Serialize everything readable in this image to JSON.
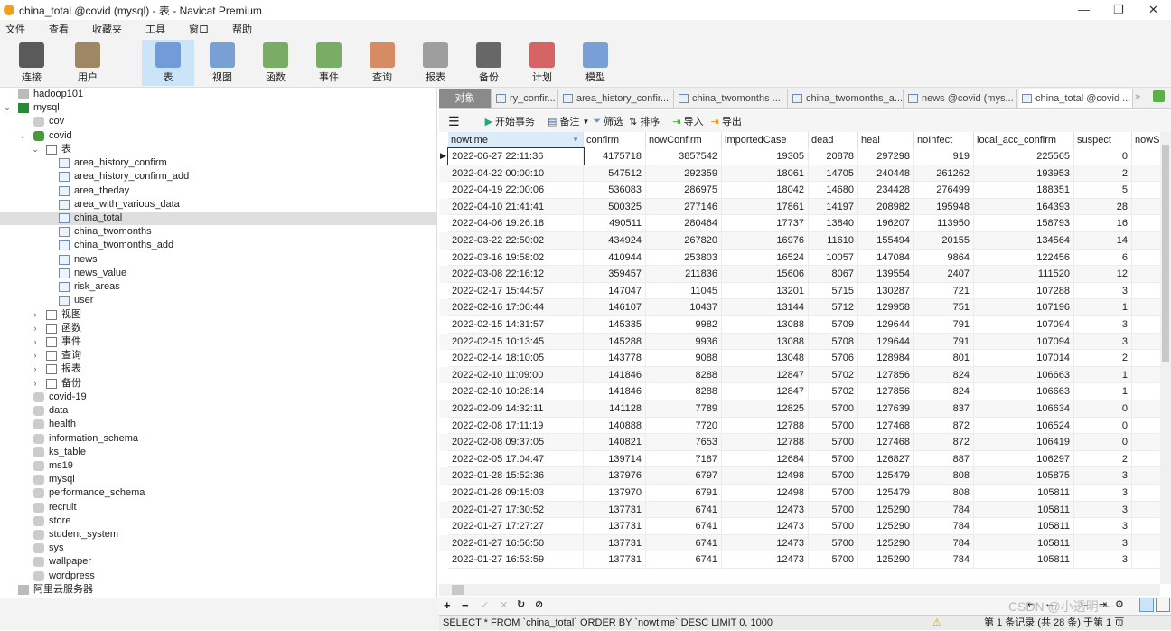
{
  "window": {
    "title": "china_total @covid (mysql) - 表 - Navicat Premium"
  },
  "menu": [
    "文件",
    "查看",
    "收藏夹",
    "工具",
    "窗口",
    "帮助"
  ],
  "toolbar": [
    {
      "label": "连接",
      "icon": "connection-icon"
    },
    {
      "label": "用户",
      "icon": "user-icon"
    },
    {
      "label": "表",
      "icon": "table-icon",
      "active": true
    },
    {
      "label": "视图",
      "icon": "view-icon"
    },
    {
      "label": "函数",
      "icon": "function-icon"
    },
    {
      "label": "事件",
      "icon": "event-icon"
    },
    {
      "label": "查询",
      "icon": "query-icon"
    },
    {
      "label": "报表",
      "icon": "report-icon"
    },
    {
      "label": "备份",
      "icon": "backup-icon"
    },
    {
      "label": "计划",
      "icon": "schedule-icon"
    },
    {
      "label": "模型",
      "icon": "model-icon"
    }
  ],
  "tree": [
    {
      "label": "hadoop101",
      "level": 0,
      "type": "conn"
    },
    {
      "label": "mysql",
      "level": 0,
      "type": "conn",
      "open": true
    },
    {
      "label": "cov",
      "level": 1,
      "type": "db"
    },
    {
      "label": "covid",
      "level": 1,
      "type": "db",
      "open": true
    },
    {
      "label": "表",
      "level": 2,
      "type": "folder",
      "open": true
    },
    {
      "label": "area_history_confirm",
      "level": 3,
      "type": "table"
    },
    {
      "label": "area_history_confirm_add",
      "level": 3,
      "type": "table"
    },
    {
      "label": "area_theday",
      "level": 3,
      "type": "table"
    },
    {
      "label": "area_with_various_data",
      "level": 3,
      "type": "table"
    },
    {
      "label": "china_total",
      "level": 3,
      "type": "table",
      "selected": true
    },
    {
      "label": "china_twomonths",
      "level": 3,
      "type": "table"
    },
    {
      "label": "china_twomonths_add",
      "level": 3,
      "type": "table"
    },
    {
      "label": "news",
      "level": 3,
      "type": "table"
    },
    {
      "label": "news_value",
      "level": 3,
      "type": "table"
    },
    {
      "label": "risk_areas",
      "level": 3,
      "type": "table"
    },
    {
      "label": "user",
      "level": 3,
      "type": "table"
    },
    {
      "label": "视图",
      "level": 2,
      "type": "folder"
    },
    {
      "label": "函数",
      "level": 2,
      "type": "folder"
    },
    {
      "label": "事件",
      "level": 2,
      "type": "folder"
    },
    {
      "label": "查询",
      "level": 2,
      "type": "folder"
    },
    {
      "label": "报表",
      "level": 2,
      "type": "folder"
    },
    {
      "label": "备份",
      "level": 2,
      "type": "folder"
    },
    {
      "label": "covid-19",
      "level": 1,
      "type": "db"
    },
    {
      "label": "data",
      "level": 1,
      "type": "db"
    },
    {
      "label": "health",
      "level": 1,
      "type": "db"
    },
    {
      "label": "information_schema",
      "level": 1,
      "type": "db"
    },
    {
      "label": "ks_table",
      "level": 1,
      "type": "db"
    },
    {
      "label": "ms19",
      "level": 1,
      "type": "db"
    },
    {
      "label": "mysql",
      "level": 1,
      "type": "db"
    },
    {
      "label": "performance_schema",
      "level": 1,
      "type": "db"
    },
    {
      "label": "recruit",
      "level": 1,
      "type": "db"
    },
    {
      "label": "store",
      "level": 1,
      "type": "db"
    },
    {
      "label": "student_system",
      "level": 1,
      "type": "db"
    },
    {
      "label": "sys",
      "level": 1,
      "type": "db"
    },
    {
      "label": "wallpaper",
      "level": 1,
      "type": "db"
    },
    {
      "label": "wordpress",
      "level": 1,
      "type": "db"
    },
    {
      "label": "阿里云服务器",
      "level": 0,
      "type": "conn"
    }
  ],
  "tabs": [
    {
      "label": "对象",
      "kind": "obj"
    },
    {
      "label": "ry_confir..."
    },
    {
      "label": "area_history_confir..."
    },
    {
      "label": "china_twomonths ..."
    },
    {
      "label": "china_twomonths_a..."
    },
    {
      "label": "news @covid (mys..."
    },
    {
      "label": "china_total @covid ...",
      "kind": "cur"
    }
  ],
  "subtoolbar": {
    "begin_tx": "开始事务",
    "note": "备注",
    "filter": "筛选",
    "sort": "排序",
    "import": "导入",
    "export": "导出"
  },
  "columns": [
    "nowtime",
    "confirm",
    "nowConfirm",
    "importedCase",
    "dead",
    "heal",
    "noInfect",
    "local_acc_confirm",
    "suspect",
    "nowS"
  ],
  "rows": [
    [
      "2022-06-27 22:11:36",
      "4175718",
      "3857542",
      "19305",
      "20878",
      "297298",
      "919",
      "225565",
      "0"
    ],
    [
      "2022-04-22 00:00:10",
      "547512",
      "292359",
      "18061",
      "14705",
      "240448",
      "261262",
      "193953",
      "2"
    ],
    [
      "2022-04-19 22:00:06",
      "536083",
      "286975",
      "18042",
      "14680",
      "234428",
      "276499",
      "188351",
      "5"
    ],
    [
      "2022-04-10 21:41:41",
      "500325",
      "277146",
      "17861",
      "14197",
      "208982",
      "195948",
      "164393",
      "28"
    ],
    [
      "2022-04-06 19:26:18",
      "490511",
      "280464",
      "17737",
      "13840",
      "196207",
      "113950",
      "158793",
      "16"
    ],
    [
      "2022-03-22 22:50:02",
      "434924",
      "267820",
      "16976",
      "11610",
      "155494",
      "20155",
      "134564",
      "14"
    ],
    [
      "2022-03-16 19:58:02",
      "410944",
      "253803",
      "16524",
      "10057",
      "147084",
      "9864",
      "122456",
      "6"
    ],
    [
      "2022-03-08 22:16:12",
      "359457",
      "211836",
      "15606",
      "8067",
      "139554",
      "2407",
      "111520",
      "12"
    ],
    [
      "2022-02-17 15:44:57",
      "147047",
      "11045",
      "13201",
      "5715",
      "130287",
      "721",
      "107288",
      "3"
    ],
    [
      "2022-02-16 17:06:44",
      "146107",
      "10437",
      "13144",
      "5712",
      "129958",
      "751",
      "107196",
      "1"
    ],
    [
      "2022-02-15 14:31:57",
      "145335",
      "9982",
      "13088",
      "5709",
      "129644",
      "791",
      "107094",
      "3"
    ],
    [
      "2022-02-15 10:13:45",
      "145288",
      "9936",
      "13088",
      "5708",
      "129644",
      "791",
      "107094",
      "3"
    ],
    [
      "2022-02-14 18:10:05",
      "143778",
      "9088",
      "13048",
      "5706",
      "128984",
      "801",
      "107014",
      "2"
    ],
    [
      "2022-02-10 11:09:00",
      "141846",
      "8288",
      "12847",
      "5702",
      "127856",
      "824",
      "106663",
      "1"
    ],
    [
      "2022-02-10 10:28:14",
      "141846",
      "8288",
      "12847",
      "5702",
      "127856",
      "824",
      "106663",
      "1"
    ],
    [
      "2022-02-09 14:32:11",
      "141128",
      "7789",
      "12825",
      "5700",
      "127639",
      "837",
      "106634",
      "0"
    ],
    [
      "2022-02-08 17:11:19",
      "140888",
      "7720",
      "12788",
      "5700",
      "127468",
      "872",
      "106524",
      "0"
    ],
    [
      "2022-02-08 09:37:05",
      "140821",
      "7653",
      "12788",
      "5700",
      "127468",
      "872",
      "106419",
      "0"
    ],
    [
      "2022-02-05 17:04:47",
      "139714",
      "7187",
      "12684",
      "5700",
      "126827",
      "887",
      "106297",
      "2"
    ],
    [
      "2022-01-28 15:52:36",
      "137976",
      "6797",
      "12498",
      "5700",
      "125479",
      "808",
      "105875",
      "3"
    ],
    [
      "2022-01-28 09:15:03",
      "137970",
      "6791",
      "12498",
      "5700",
      "125479",
      "808",
      "105811",
      "3"
    ],
    [
      "2022-01-27 17:30:52",
      "137731",
      "6741",
      "12473",
      "5700",
      "125290",
      "784",
      "105811",
      "3"
    ],
    [
      "2022-01-27 17:27:27",
      "137731",
      "6741",
      "12473",
      "5700",
      "125290",
      "784",
      "105811",
      "3"
    ],
    [
      "2022-01-27 16:56:50",
      "137731",
      "6741",
      "12473",
      "5700",
      "125290",
      "784",
      "105811",
      "3"
    ],
    [
      "2022-01-27 16:53:59",
      "137731",
      "6741",
      "12473",
      "5700",
      "125290",
      "784",
      "105811",
      "3"
    ]
  ],
  "status": {
    "sql": "SELECT * FROM `china_total` ORDER BY `nowtime` DESC LIMIT 0, 1000",
    "record": "第 1 条记录 (共 28 条) 于第 1 页"
  },
  "watermark": "CSDN @小透明~~"
}
